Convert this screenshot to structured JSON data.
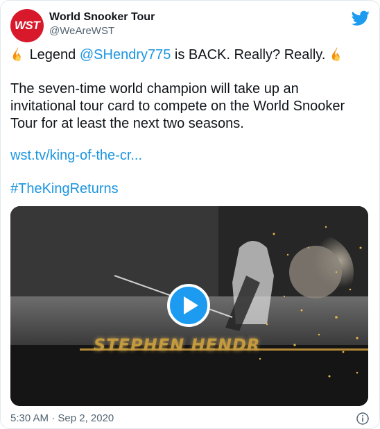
{
  "author": {
    "display_name": "World Snooker Tour",
    "handle": "@WeAreWST",
    "avatar_text": "WST",
    "avatar_color": "#d7192b"
  },
  "tweet": {
    "line1_pre": "Legend ",
    "line1_mention": "@SHendry775",
    "line1_post": " is BACK. Really? Really. ",
    "line2": "The seven-time world champion will take up an",
    "line3": "invitational tour card to compete on the World Snooker",
    "line4": "Tour for at least the next two seasons.",
    "link": "wst.tv/king-of-the-cr...",
    "hashtag": "#TheKingReturns"
  },
  "media": {
    "type": "video",
    "caption_text": "STEPHEN HENDR"
  },
  "footer": {
    "timestamp": "5:30 AM · Sep 2, 2020"
  },
  "colors": {
    "link": "#1b95e0",
    "twitter_blue": "#1d9bf0",
    "secondary_text": "#536471"
  },
  "icons": [
    "twitter-bird-icon",
    "fire-emoji-icon",
    "play-icon",
    "info-icon"
  ]
}
